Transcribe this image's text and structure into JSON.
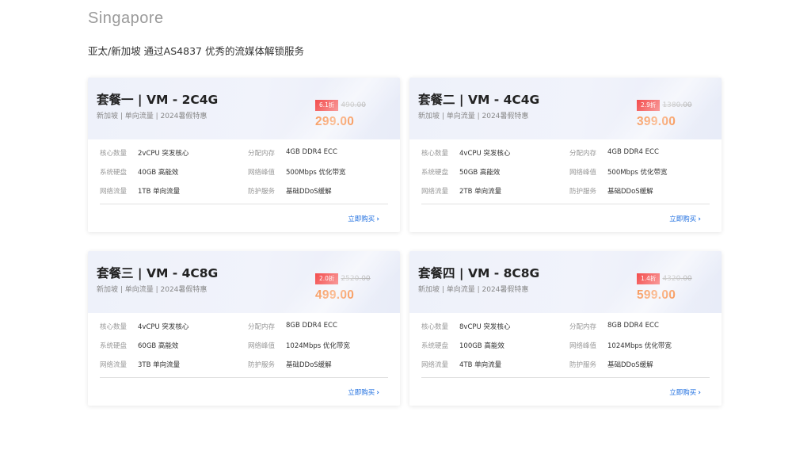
{
  "region": {
    "title": "Singapore",
    "description": "亚太/新加坡 通过AS4837 优秀的流媒体解锁服务"
  },
  "plans": [
    {
      "name": "套餐一 | VM - 2C4G",
      "subtitle": "新加坡 | 单向流量 | 2024暑假特惠",
      "discount": "6.1折",
      "original_price": "490.00",
      "price": "299.00",
      "specs": [
        {
          "label": "核心数量",
          "value": "2vCPU 突发核心"
        },
        {
          "label": "分配内存",
          "value": "4GB DDR4 ECC"
        },
        {
          "label": "系统硬盘",
          "value": "40GB 高能效"
        },
        {
          "label": "网络峰值",
          "value": "500Mbps 优化带宽"
        },
        {
          "label": "网络流量",
          "value": "1TB 单向流量"
        },
        {
          "label": "防护服务",
          "value": "基础DDoS缓解"
        }
      ],
      "buy_label": "立即购买"
    },
    {
      "name": "套餐二 | VM - 4C4G",
      "subtitle": "新加坡 | 单向流量 | 2024暑假特惠",
      "discount": "2.9折",
      "original_price": "1380.00",
      "price": "399.00",
      "specs": [
        {
          "label": "核心数量",
          "value": "4vCPU 突发核心"
        },
        {
          "label": "分配内存",
          "value": "4GB DDR4 ECC"
        },
        {
          "label": "系统硬盘",
          "value": "50GB 高能效"
        },
        {
          "label": "网络峰值",
          "value": "500Mbps 优化带宽"
        },
        {
          "label": "网络流量",
          "value": "2TB 单向流量"
        },
        {
          "label": "防护服务",
          "value": "基础DDoS缓解"
        }
      ],
      "buy_label": "立即购买"
    },
    {
      "name": "套餐三 | VM - 4C8G",
      "subtitle": "新加坡 | 单向流量 | 2024暑假特惠",
      "discount": "2.0折",
      "original_price": "2520.00",
      "price": "499.00",
      "specs": [
        {
          "label": "核心数量",
          "value": "4vCPU 突发核心"
        },
        {
          "label": "分配内存",
          "value": "8GB DDR4 ECC"
        },
        {
          "label": "系统硬盘",
          "value": "60GB 高能效"
        },
        {
          "label": "网络峰值",
          "value": "1024Mbps 优化带宽"
        },
        {
          "label": "网络流量",
          "value": "3TB 单向流量"
        },
        {
          "label": "防护服务",
          "value": "基础DDoS缓解"
        }
      ],
      "buy_label": "立即购买"
    },
    {
      "name": "套餐四 | VM - 8C8G",
      "subtitle": "新加坡 | 单向流量 | 2024暑假特惠",
      "discount": "1.4折",
      "original_price": "4320.00",
      "price": "599.00",
      "specs": [
        {
          "label": "核心数量",
          "value": "8vCPU 突发核心"
        },
        {
          "label": "分配内存",
          "value": "8GB DDR4 ECC"
        },
        {
          "label": "系统硬盘",
          "value": "100GB 高能效"
        },
        {
          "label": "网络峰值",
          "value": "1024Mbps 优化带宽"
        },
        {
          "label": "网络流量",
          "value": "4TB 单向流量"
        },
        {
          "label": "防护服务",
          "value": "基础DDoS缓解"
        }
      ],
      "buy_label": "立即购买"
    }
  ],
  "colors": {
    "accent_price": "#f5721d",
    "discount_badge": "#f23a3a",
    "link": "#1f6fe0"
  },
  "icons": {
    "buy_link": "chevron-right-icon"
  }
}
